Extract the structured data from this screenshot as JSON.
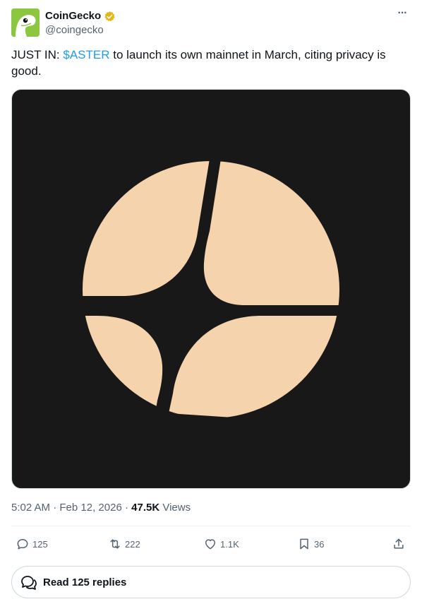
{
  "author": {
    "display_name": "CoinGecko",
    "handle": "@coingecko",
    "verified": true,
    "avatar_color": "#8dc63f"
  },
  "tweet": {
    "text_prefix": "JUST IN: ",
    "cashtag": "$ASTER",
    "text_suffix": " to launch its own mainnet in March, citing privacy is good."
  },
  "media": {
    "logo_color": "#f5d3ad",
    "background_color": "#181818"
  },
  "meta": {
    "time": "5:02 AM",
    "date": "Feb 12, 2026",
    "views_count": "47.5K",
    "views_label": "Views"
  },
  "actions": {
    "replies": "125",
    "reposts": "222",
    "likes": "1.1K",
    "bookmarks": "36"
  },
  "read_replies": {
    "label": "Read 125 replies"
  },
  "colors": {
    "accent": "#1d9bf0",
    "muted": "#536471",
    "verified_gold": "#e2b719"
  }
}
